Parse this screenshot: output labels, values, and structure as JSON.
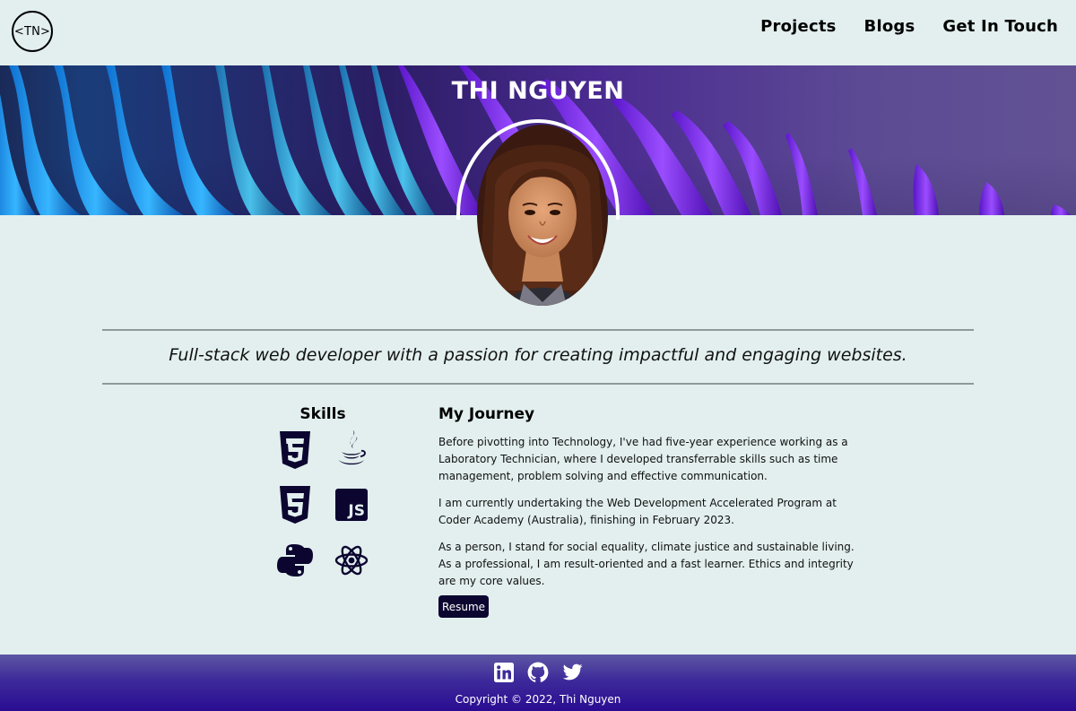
{
  "header": {
    "logo_text": "<TN>",
    "nav": [
      {
        "label": "Projects"
      },
      {
        "label": "Blogs"
      },
      {
        "label": "Get In Touch"
      }
    ]
  },
  "hero": {
    "name": "THI NGUYEN",
    "avatar_alt": "Thi Nguyen"
  },
  "tagline": "Full-stack web developer with a passion for creating impactful and engaging websites.",
  "skills": {
    "title": "Skills",
    "icons": [
      "css3-icon",
      "java-icon",
      "html5-icon",
      "javascript-icon",
      "python-icon",
      "react-icon"
    ],
    "js_label": "JS"
  },
  "journey": {
    "title": "My Journey",
    "paragraphs": [
      "Before pivotting into Technology, I've had five-year experience working as a Laboratory Technician, where I developed transferrable skills such as time management, problem solving and effective communication.",
      "I am currently undertaking the Web Development Accelerated Program at Coder Academy (Australia), finishing in February 2023.",
      "As a person, I stand for social equality, climate justice and sustainable living. As a professional, I am result-oriented and a fast learner. Ethics and integrity are my core values."
    ],
    "resume_label": "Resume"
  },
  "footer": {
    "social": [
      "linkedin-icon",
      "github-icon",
      "twitter-icon"
    ],
    "copyright": "Copyright © 2022, Thi Nguyen"
  },
  "colors": {
    "page_bg": "#e2efee",
    "icon_navy": "#0c0530",
    "footer_top": "#5d57a3",
    "footer_bottom": "#2a0c92"
  }
}
